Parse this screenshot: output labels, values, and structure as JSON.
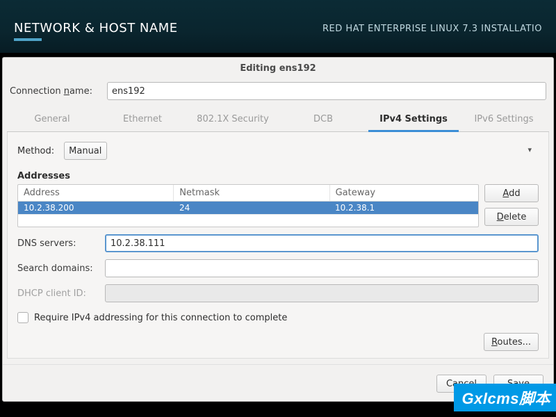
{
  "header": {
    "left": "NETWORK & HOST NAME",
    "right": "RED HAT ENTERPRISE LINUX 7.3 INSTALLATIO"
  },
  "dialog": {
    "title": "Editing ens192",
    "connection_name_label_pre": "Connection ",
    "connection_name_label_ul": "n",
    "connection_name_label_post": "ame:",
    "connection_name_value": "ens192",
    "tabs": [
      "General",
      "Ethernet",
      "802.1X Security",
      "DCB",
      "IPv4 Settings",
      "IPv6 Settings"
    ],
    "active_tab_index": 4,
    "method_label_ul": "M",
    "method_label_post": "ethod:",
    "method_value": "Manual",
    "addresses_label": "Addresses",
    "addr_headers": [
      "Address",
      "Netmask",
      "Gateway"
    ],
    "addr_row": {
      "address": "10.2.38.200",
      "netmask": "24",
      "gateway": "10.2.38.1"
    },
    "add_btn_ul": "A",
    "add_btn_post": "dd",
    "delete_btn_ul": "D",
    "delete_btn_post": "elete",
    "dns_label_pre": "DNS ser",
    "dns_label_ul": "v",
    "dns_label_post": "ers:",
    "dns_value": "10.2.38.111",
    "search_label_pre": "S",
    "search_label_ul": "e",
    "search_label_post": "arch domains:",
    "search_value": "",
    "dhcp_label": "DHCP client ID:",
    "dhcp_value": "",
    "require_checkbox_pre": "Require IPv",
    "require_checkbox_ul": "4",
    "require_checkbox_post": " addressing for this connection to complete",
    "routes_btn_ul": "R",
    "routes_btn_post": "outes...",
    "cancel": "Cancel",
    "save": "Save"
  },
  "watermark": "Gxlcms脚本"
}
